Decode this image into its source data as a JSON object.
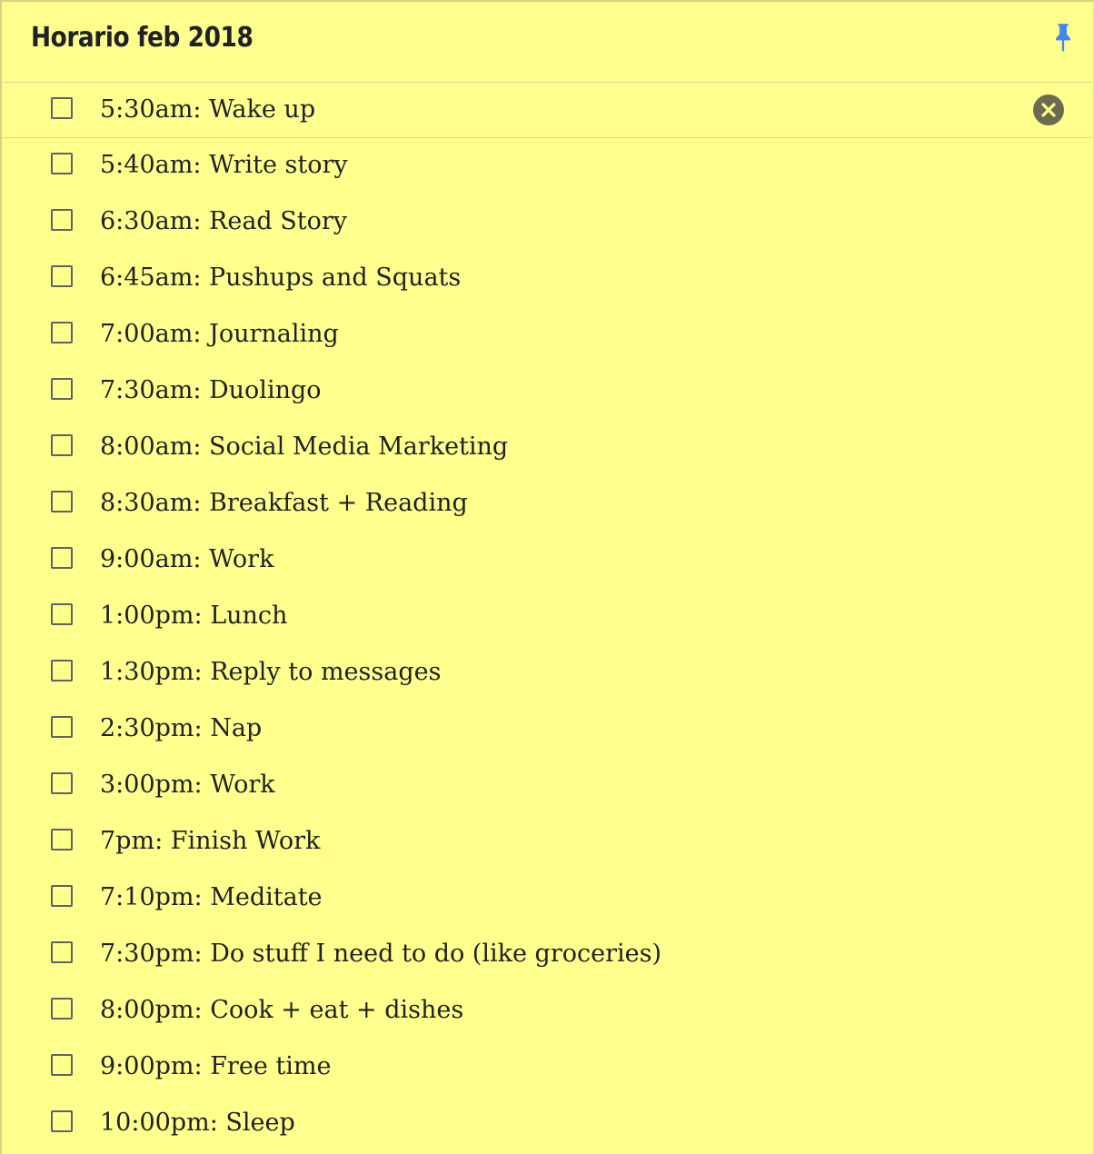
{
  "note": {
    "title": "Horario feb 2018",
    "background": "#ffff8d",
    "pin_color": "#4285f4",
    "items": [
      {
        "label": "5:30am: Wake up",
        "checked": false
      },
      {
        "label": "5:40am: Write story",
        "checked": false
      },
      {
        "label": "6:30am: Read Story",
        "checked": false
      },
      {
        "label": "6:45am: Pushups and Squats",
        "checked": false
      },
      {
        "label": "7:00am: Journaling",
        "checked": false
      },
      {
        "label": "7:30am: Duolingo",
        "checked": false
      },
      {
        "label": "8:00am: Social Media Marketing",
        "checked": false
      },
      {
        "label": "8:30am: Breakfast + Reading",
        "checked": false
      },
      {
        "label": "9:00am: Work",
        "checked": false
      },
      {
        "label": "1:00pm: Lunch",
        "checked": false
      },
      {
        "label": "1:30pm: Reply to messages",
        "checked": false
      },
      {
        "label": "2:30pm: Nap",
        "checked": false
      },
      {
        "label": "3:00pm: Work",
        "checked": false
      },
      {
        "label": "7pm: Finish Work",
        "checked": false
      },
      {
        "label": "7:10pm: Meditate",
        "checked": false
      },
      {
        "label": "7:30pm: Do stuff I need to do (like groceries)",
        "checked": false
      },
      {
        "label": "8:00pm: Cook + eat + dishes",
        "checked": false
      },
      {
        "label": "9:00pm: Free time",
        "checked": false
      },
      {
        "label": "10:00pm: Sleep",
        "checked": false
      }
    ]
  }
}
